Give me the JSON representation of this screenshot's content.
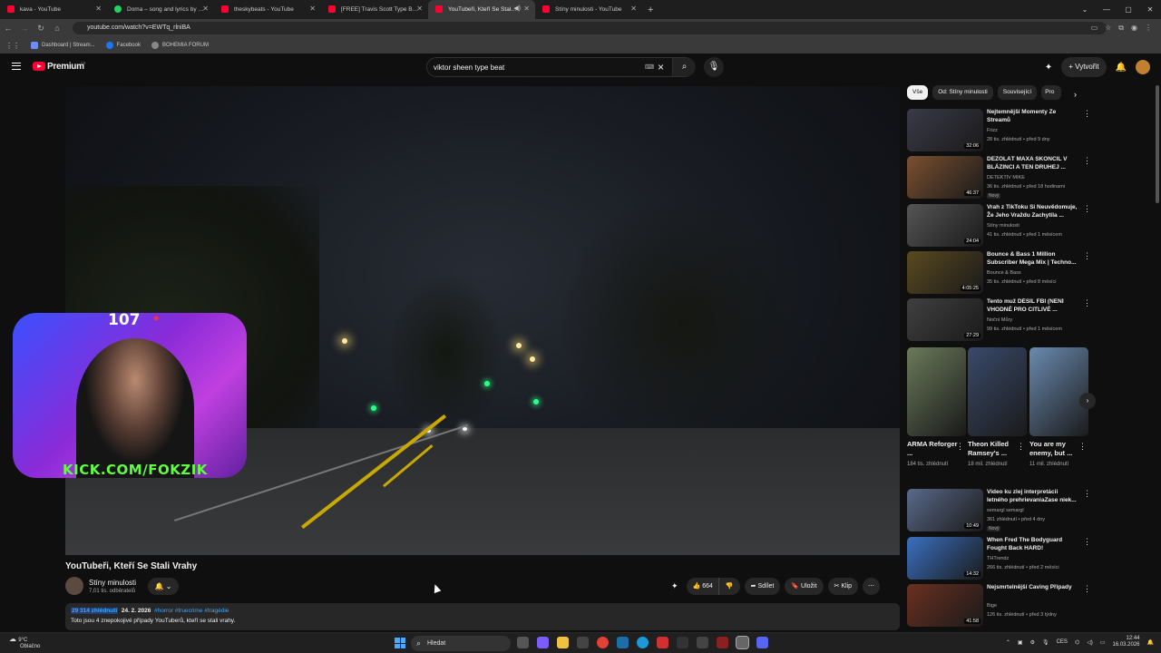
{
  "browser": {
    "tabs": [
      {
        "label": "kava - YouTube",
        "active": false
      },
      {
        "label": "Doma – song and lyrics by tolu",
        "active": false
      },
      {
        "label": "theskybeats - YouTube",
        "active": false
      },
      {
        "label": "[FREE] Travis Scott Type Beat -",
        "active": false
      },
      {
        "label": "YouTubeři, Kteří Se Stali Vra",
        "active": true
      },
      {
        "label": "Stíny minulosti - YouTube",
        "active": false
      }
    ],
    "url": "youtube.com/watch?v=EWTq_rlniBA",
    "bookmarks": [
      "Dashboard | Stream...",
      "Facebook",
      "BOHEMIA FORUM"
    ]
  },
  "youtube": {
    "logo": "Premium",
    "region": "CZ",
    "search_query": "viktor sheen type beat",
    "create_label": "Vytvořit"
  },
  "overlay": {
    "viewer_count": "107",
    "stream_tag": "KICK.COM/FOKZIK"
  },
  "video": {
    "title": "YouTubeři, Kteří Se Stali Vrahy",
    "channel": "Stíny minulosti",
    "subscribers": "7,01 tis. odběratelů",
    "likes": "664",
    "share": "Sdílet",
    "save": "Uložit",
    "clip": "Klip",
    "views": "29 314 zhlédnutí",
    "date": "24. 2. 2026",
    "tags": "#horror #truecrime #tragédie",
    "description": "Toto jsou 4 znepokojivé případy YouTuberů, kteří se stali vrahy."
  },
  "sidebar": {
    "chips": [
      "Vše",
      "Od: Stíny minulosti",
      "Související",
      "Pro"
    ],
    "recs_top": [
      {
        "title": "Nejtemnější Momenty Ze Streamů",
        "channel": "Frizz",
        "meta": "28 tis. zhlédnutí • před 9 dny",
        "duration": "32:06",
        "badge": "",
        "color": "#3a3a48"
      },
      {
        "title": "DEZOLÁT MAXA SKONČIL V BLÁZINCI A TEN DRUHEJ ...",
        "channel": "DETEKTIV MIKE",
        "meta": "36 tis. zhlédnutí • před 18 hodinami",
        "duration": "46:37",
        "badge": "Nový",
        "color": "#7a5030"
      },
      {
        "title": "Vrah z TikToku Si Neuvědomuje, Že Jeho Vraždu Zachytila ...",
        "channel": "Stíny minulosti",
        "meta": "41 tis. zhlédnutí • před 1 měsícem",
        "duration": "24:04",
        "badge": "",
        "color": "#555555"
      },
      {
        "title": "Bounce & Bass 1 Million Subscriber Mega Mix | Techno...",
        "channel": "Bounce & Bass",
        "meta": "35 tis. zhlédnutí • před 8 měsíci",
        "duration": "4:05:25",
        "badge": "",
        "color": "#5a4a20"
      },
      {
        "title": "Tento muž DĚSIL FBI (NENÍ VHODNÉ PRO CITLIVÉ ...",
        "channel": "Noční Můry",
        "meta": "99 tis. zhlédnutí • před 1 měsícem",
        "duration": "27:29",
        "badge": "",
        "color": "#404040"
      }
    ],
    "shorts": [
      {
        "title": "ARMA Reforger ...",
        "views": "184 tis. zhlédnutí",
        "color": "#6a7a5a"
      },
      {
        "title": "Theon Killed Ramsey's ...",
        "views": "18 mil. zhlédnutí",
        "color": "#3a4a6a"
      },
      {
        "title": "You are my enemy, but ...",
        "views": "11 mil. zhlédnutí",
        "color": "#6a8ab0"
      }
    ],
    "recs_bottom": [
      {
        "title": "Video ku zlej interpretácii letného prehrievaniaZase niek...",
        "channel": "semargl semargl",
        "meta": "361 zhlédnutí • před 4 dny",
        "duration": "10:49",
        "badge": "Nový",
        "color": "#5a6a8a"
      },
      {
        "title": "When Fred The Bodyguard Fought Back HARD!",
        "channel": "THTrendz",
        "meta": "266 tis. zhlédnutí • před 2 měsíci",
        "duration": "14:32",
        "badge": "",
        "color": "#3a70c0"
      },
      {
        "title": "Nejsmrtelnější Caving Případy",
        "channel": "Bige",
        "meta": "126 tis. zhlédnutí • před 3 týdny",
        "duration": "41:58",
        "badge": "",
        "color": "#6a3020"
      }
    ]
  },
  "taskbar": {
    "temp": "9°C",
    "weather": "Oblačno",
    "search": "Hledat",
    "lang": "CES",
    "time": "12:44",
    "date": "16.03.2026"
  }
}
